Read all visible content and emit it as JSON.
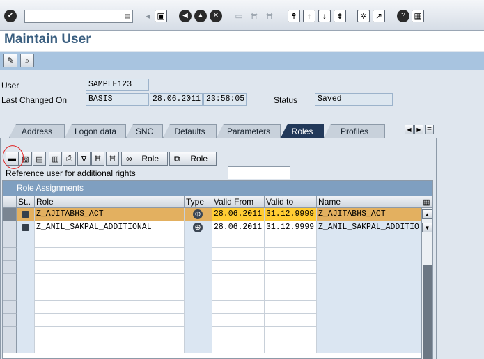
{
  "toolbar": {
    "icons": [
      "enter-icon",
      "save-icon",
      "back-icon",
      "exit-icon",
      "cancel-icon",
      "print-icon",
      "find-icon",
      "find-next-icon",
      "first-page-icon",
      "previous-page-icon",
      "next-page-icon",
      "last-page-icon",
      "new-session-icon",
      "shortcut-icon",
      "help-icon",
      "customize-layout-icon"
    ]
  },
  "title": "Maintain User",
  "app_toolbar": {
    "icons": [
      "change-icon",
      "display-icon"
    ]
  },
  "header": {
    "user_label": "User",
    "user_value": "SAMPLE123",
    "last_changed_label": "Last Changed On",
    "last_changed_by": "BASIS",
    "last_changed_date": "28.06.2011",
    "last_changed_time": "23:58:05",
    "status_label": "Status",
    "status_value": "Saved"
  },
  "tabs": [
    {
      "label": "Address",
      "active": false
    },
    {
      "label": "Logon data",
      "active": false
    },
    {
      "label": "SNC",
      "active": false
    },
    {
      "label": "Defaults",
      "active": false
    },
    {
      "label": "Parameters",
      "active": false
    },
    {
      "label": "Roles",
      "active": true
    },
    {
      "label": "Profiles",
      "active": false
    }
  ],
  "roles_toolbar": {
    "icons": [
      "insert-row-icon",
      "delete-row-icon",
      "details-icon",
      "select-all-icon",
      "print-list-icon",
      "filter-icon",
      "find-icon",
      "find-next-icon",
      "display-role-icon"
    ],
    "role_button_1": "Role",
    "role_button_2": "Role"
  },
  "reference_user_label": "Reference user for additional rights",
  "reference_user_value": "",
  "grid": {
    "title": "Role Assignments",
    "columns": [
      "St..",
      "Role",
      "Type",
      "Valid From",
      "Valid to",
      "Name"
    ],
    "rows": [
      {
        "role": "Z_AJITABHS_ACT",
        "valid_from": "28.06.2011",
        "valid_to": "31.12.9999",
        "name": "Z_AJITABHS_ACT",
        "highlight": true
      },
      {
        "role": "Z_ANIL_SAKPAL_ADDITIONAL",
        "valid_from": "28.06.2011",
        "valid_to": "31.12.9999",
        "name": "Z_ANIL_SAKPAL_ADDITIO",
        "highlight": false
      }
    ]
  },
  "colors": {
    "title": "#3b5f80",
    "app_toolbar": "#a8c4e0",
    "active_tab": "#22395a",
    "grid_title": "#7f9fc0",
    "highlight_row": "#e3b060",
    "highlight_dates": "#ffcc33",
    "annotation": "#e02020"
  }
}
